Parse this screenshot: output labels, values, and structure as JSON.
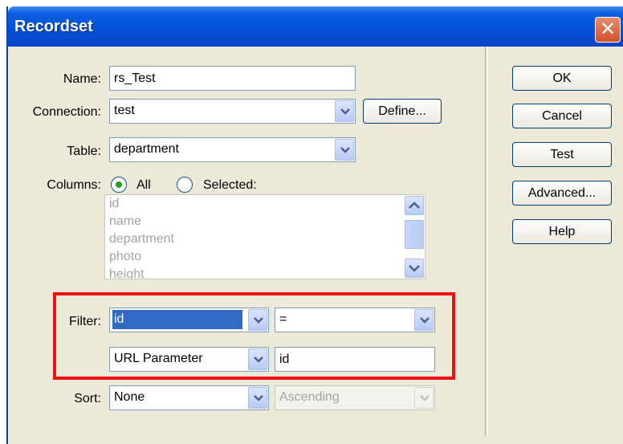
{
  "window": {
    "title": "Recordset"
  },
  "form": {
    "name": {
      "label": "Name:",
      "value": "rs_Test"
    },
    "connection": {
      "label": "Connection:",
      "value": "test",
      "define_button": "Define..."
    },
    "table": {
      "label": "Table:",
      "value": "department"
    },
    "columns": {
      "label": "Columns:",
      "options": [
        {
          "label": "All",
          "selected": true
        },
        {
          "label": "Selected:",
          "selected": false
        }
      ],
      "list": [
        "id",
        "name",
        "department",
        "photo",
        "height"
      ]
    },
    "filter": {
      "label": "Filter:",
      "column": "id",
      "operator": "=",
      "source": "URL Parameter",
      "value": "id"
    },
    "sort": {
      "label": "Sort:",
      "column": "None",
      "order": "Ascending"
    }
  },
  "buttons": {
    "ok": "OK",
    "cancel": "Cancel",
    "test": "Test",
    "advanced": "Advanced...",
    "help": "Help"
  },
  "colors": {
    "titlebar": "#0451d8",
    "dialog_bg": "#ece9d8",
    "selection": "#316ac5",
    "highlight_box": "#ee1111"
  }
}
